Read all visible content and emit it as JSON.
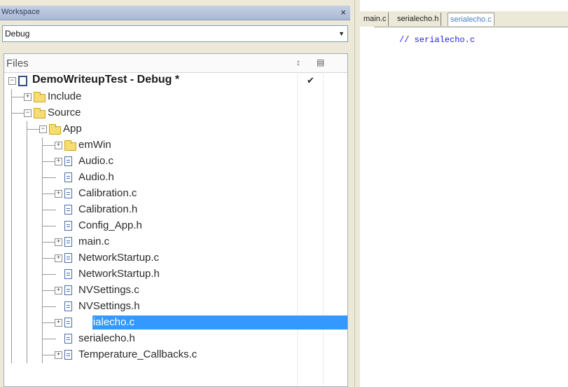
{
  "workspace": {
    "title": "Workspace",
    "close_glyph": "×",
    "configuration": "Debug",
    "files_header": "Files",
    "header_icons": [
      "sort-icon",
      "options-icon"
    ]
  },
  "tree": [
    {
      "label": "DemoWriteupTest - Debug *",
      "icon": "project-icon",
      "expander": "minus",
      "checked": true
    },
    {
      "label": "Include",
      "icon": "folder-icon",
      "expander": "plus"
    },
    {
      "label": "Source",
      "icon": "folder-icon",
      "expander": "minus"
    },
    {
      "label": "App",
      "icon": "folder-icon",
      "expander": "minus"
    },
    {
      "label": "emWin",
      "icon": "folder-icon",
      "expander": "plus"
    },
    {
      "label": "Audio.c",
      "icon": "file-icon",
      "expander": "plus"
    },
    {
      "label": "Audio.h",
      "icon": "file-icon",
      "expander": "none"
    },
    {
      "label": "Calibration.c",
      "icon": "file-icon",
      "expander": "plus"
    },
    {
      "label": "Calibration.h",
      "icon": "file-icon",
      "expander": "none"
    },
    {
      "label": "Config_App.h",
      "icon": "file-icon",
      "expander": "none"
    },
    {
      "label": "main.c",
      "icon": "file-icon",
      "expander": "plus"
    },
    {
      "label": "NetworkStartup.c",
      "icon": "file-icon",
      "expander": "plus"
    },
    {
      "label": "NetworkStartup.h",
      "icon": "file-icon",
      "expander": "none"
    },
    {
      "label": "NVSettings.c",
      "icon": "file-icon",
      "expander": "plus"
    },
    {
      "label": "NVSettings.h",
      "icon": "file-icon",
      "expander": "none"
    },
    {
      "label": "serialecho.c",
      "icon": "file-icon",
      "expander": "plus",
      "selected": true
    },
    {
      "label": "serialecho.h",
      "icon": "file-icon",
      "expander": "none"
    },
    {
      "label": "Temperature_Callbacks.c",
      "icon": "file-icon",
      "expander": "plus"
    }
  ],
  "editor": {
    "tabs": [
      {
        "label": "main.c",
        "active": false
      },
      {
        "label": "serialecho.h",
        "active": false
      },
      {
        "label": "serialecho.c",
        "active": true
      }
    ],
    "code_line": "// serialecho.c"
  },
  "colors": {
    "selection": "#3399ff",
    "comment": "#1c1ce0",
    "active_tab_text": "#4a7fc1"
  }
}
